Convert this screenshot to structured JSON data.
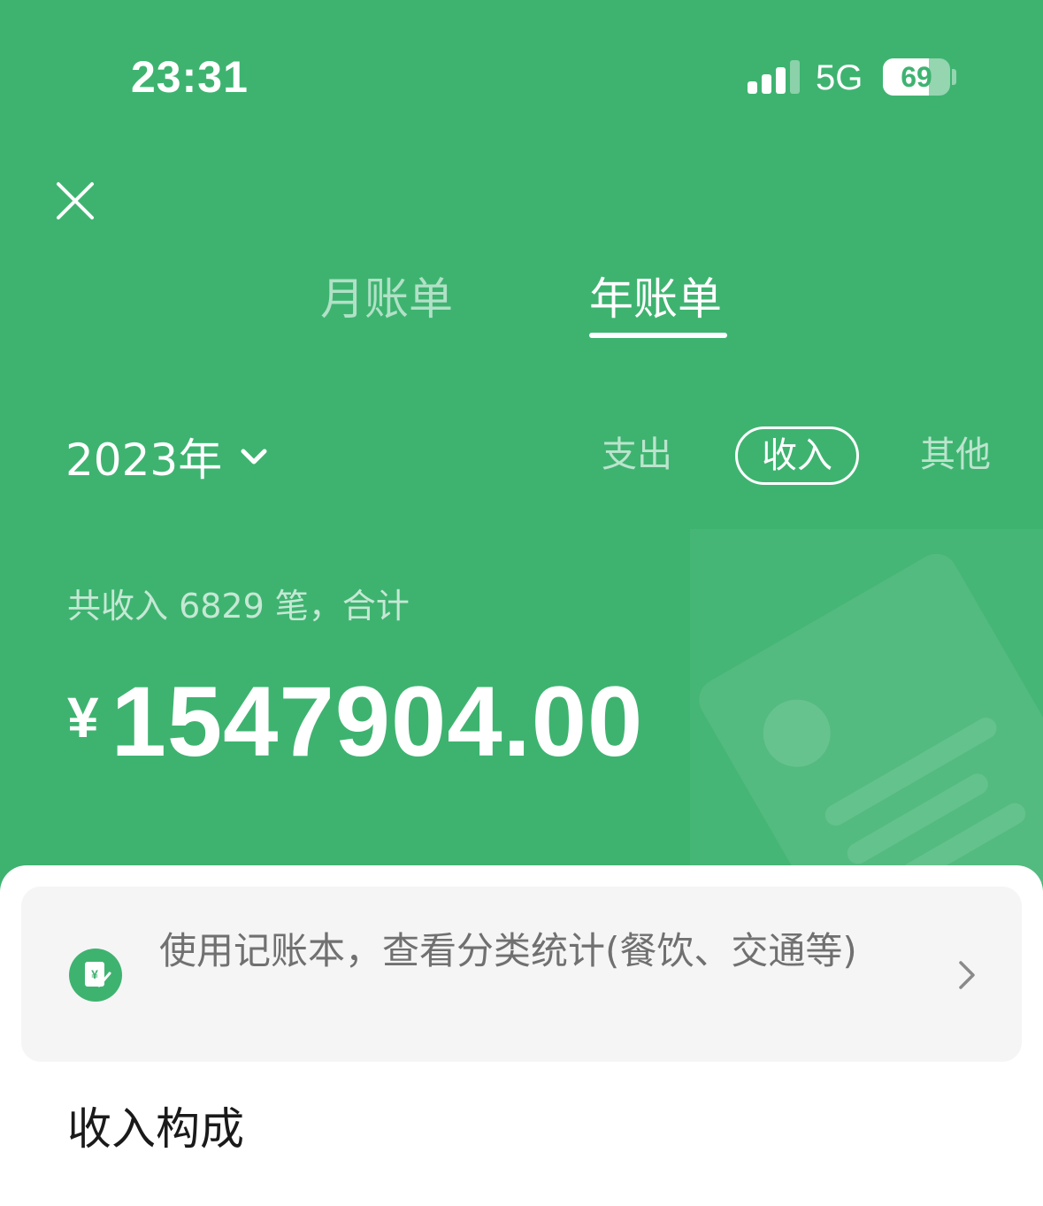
{
  "status_bar": {
    "time": "23:31",
    "network": "5G",
    "battery": "69",
    "battery_level": 0.69,
    "signal_bars": 3
  },
  "header": {
    "close_icon": "close-icon"
  },
  "tabs": [
    {
      "label": "月账单",
      "active": false
    },
    {
      "label": "年账单",
      "active": true
    }
  ],
  "filters": {
    "year": "2023年",
    "segments": [
      {
        "label": "支出",
        "active": false
      },
      {
        "label": "收入",
        "active": true
      },
      {
        "label": "其他",
        "active": false
      }
    ]
  },
  "summary": {
    "text": "共收入 6829 笔，合计",
    "currency": "¥",
    "amount": "1547904.00"
  },
  "banner": {
    "text": "使用记账本，查看分类统计(餐饮、交通等)",
    "icon": "ledger-icon"
  },
  "section": {
    "title": "收入构成"
  },
  "colors": {
    "brand": "#3eb370",
    "banner_bg": "#f5f5f5",
    "text_dark": "#1a1a1a",
    "text_muted": "#707070"
  }
}
